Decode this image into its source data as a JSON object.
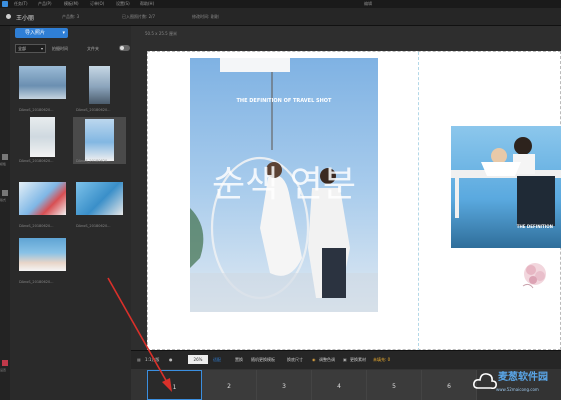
{
  "menubar": {
    "items": [
      "任务(T)",
      "产品(P)",
      "模板(M)",
      "订单(O)",
      "设置(S)",
      "帮助(H)"
    ],
    "window_title": "编辑"
  },
  "project": {
    "name": "王小丽",
    "product_count": "产品数: 3",
    "imported_count": "已入图照片数: 2/7",
    "modified_time": "修改时间: 刚刚"
  },
  "left_panel": {
    "import_label": "导入照片",
    "filter_value": "全部",
    "sort_label": "拍摄时间",
    "folder_label": "文件夹",
    "thumbnails": [
      {
        "label": "DAnoS_20180620...",
        "selected": false
      },
      {
        "label": "DAnoS_20180620...",
        "selected": false
      },
      {
        "label": "DAnoS_20180620...",
        "selected": false
      },
      {
        "label": "DAnoS_20180620...",
        "selected": true
      },
      {
        "label": "DAnoS_20180620...",
        "selected": false
      },
      {
        "label": "DAnoS_20180620...",
        "selected": false
      },
      {
        "label": "DAnoS_20180620...",
        "selected": false
      }
    ]
  },
  "side_strip": {
    "labels": [
      "模板",
      "版式",
      "设置"
    ]
  },
  "canvas": {
    "size_label": "50.5 x 25.5 厘米",
    "photo_title": "THE DEFINITION OF TRAVEL SHOT",
    "photo_korean": "순색 연분",
    "side_photo_text": "THE DEFINITION"
  },
  "bottom_toolbar": {
    "layout_label": "1:1方版",
    "zoom": "26%",
    "actions": [
      "适配",
      "置换",
      "随机更换模板",
      "换底尺寸",
      "调整色调",
      "更换素材"
    ],
    "unfinished_label": "未填充: 0"
  },
  "pages": [
    "1",
    "2",
    "3",
    "4",
    "5",
    "6"
  ],
  "watermark": {
    "title": "麦葱软件园",
    "url": "www.52maicong.com"
  },
  "colors": {
    "accent": "#2f7fd6",
    "arrow": "#d9302a"
  }
}
